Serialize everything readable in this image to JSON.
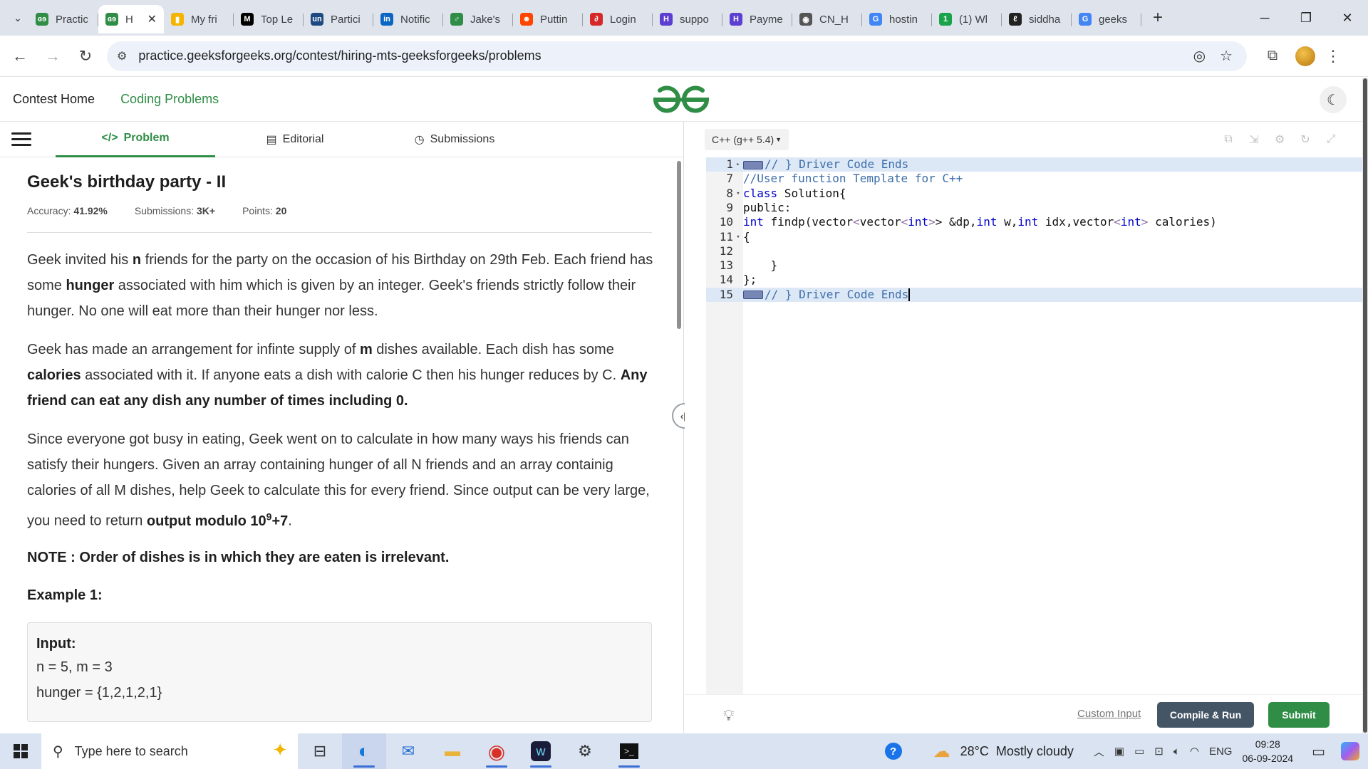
{
  "browser": {
    "tabs": [
      {
        "label": "Practic",
        "fav": "geeks-logo-icon",
        "color": "#2f8d46",
        "glyph": "ɞɘ"
      },
      {
        "label": "H",
        "fav": "geeks-logo-icon",
        "color": "#2f8d46",
        "glyph": "ɞɘ",
        "active": true
      },
      {
        "label": "My fri",
        "fav": "bar-chart-icon",
        "color": "#f4b400",
        "glyph": "▮"
      },
      {
        "label": "Top Le",
        "fav": "medium-icon",
        "color": "#000000",
        "glyph": "M"
      },
      {
        "label": "Partici",
        "fav": "unstop-icon",
        "color": "#1c4980",
        "glyph": "un"
      },
      {
        "label": "Notific",
        "fav": "linkedin-icon",
        "color": "#0a66c2",
        "glyph": "in"
      },
      {
        "label": "Jake's",
        "fav": "leetcode-icon",
        "color": "#2f8d46",
        "glyph": "♂"
      },
      {
        "label": "Puttin",
        "fav": "reddit-icon",
        "color": "#ff4500",
        "glyph": "☻"
      },
      {
        "label": "Login",
        "fav": "login-icon",
        "color": "#d62828",
        "glyph": "∂"
      },
      {
        "label": "suppo",
        "fav": "support-icon",
        "color": "#5b3fd1",
        "glyph": "H"
      },
      {
        "label": "Payme",
        "fav": "payment-icon",
        "color": "#5b3fd1",
        "glyph": "H"
      },
      {
        "label": "CN_H",
        "fav": "globe-icon",
        "color": "#555555",
        "glyph": "◉"
      },
      {
        "label": "hostin",
        "fav": "google-icon",
        "color": "#4285f4",
        "glyph": "G"
      },
      {
        "label": "(1) Wl",
        "fav": "whatsapp-icon",
        "color": "#1aa34a",
        "glyph": "1"
      },
      {
        "label": "siddha",
        "fav": "leetcode-icon",
        "color": "#222222",
        "glyph": "ℓ"
      },
      {
        "label": "geeks",
        "fav": "google-icon",
        "color": "#4285f4",
        "glyph": "G"
      }
    ],
    "url": "practice.geeksforgeeks.org/contest/hiring-mts-geeksforgeeks/problems"
  },
  "header": {
    "contest_home": "Contest Home",
    "coding_problems": "Coding Problems"
  },
  "problem_tabs": {
    "problem": "Problem",
    "editorial": "Editorial",
    "submissions": "Submissions"
  },
  "problem": {
    "title": "Geek's birthday party - II",
    "accuracy_label": "Accuracy:",
    "accuracy": "41.92%",
    "submissions_label": "Submissions:",
    "submissions": "3K+",
    "points_label": "Points:",
    "points": "20",
    "p1_a": "Geek invited his ",
    "p1_b": "n",
    "p1_c": " friends for the party on the occasion of his Birthday on 29th Feb. Each friend has some ",
    "p1_d": "hunger",
    "p1_e": " associated with him which is given by an integer. Geek's friends strictly follow their hunger. No one will eat more than their hunger nor less.",
    "p2_a": "Geek has made an arrangement for infinte supply of ",
    "p2_b": "m",
    "p2_c": " dishes available. Each dish has some ",
    "p2_d": "calories",
    "p2_e": " associated with it. If anyone eats a dish with calorie C then his hunger reduces by C. ",
    "p2_f": "Any friend can eat any dish any number of times including 0.",
    "p3_a": "Since everyone got busy in eating, Geek went on to calculate in how many ways his friends can satisfy their hungers. Given an array containing hunger of all N friends and an array containig calories of all M dishes, help Geek to calculate this for every friend. Since output can be very large, you need to return ",
    "p3_b": "output modulo 10",
    "p3_sup": "9",
    "p3_c": "+7",
    "p3_d": ".",
    "note": "NOTE : Order of dishes is in which they are eaten is irrelevant.",
    "example_heading": "Example 1:",
    "input_label": "Input:",
    "input_line1": "n = 5, m = 3",
    "input_line2": "hunger = {1,2,1,2,1}"
  },
  "editor": {
    "language": "C++ (g++ 5.4)",
    "lines": [
      {
        "num": "1",
        "fold": "▸",
        "fold_marker": true,
        "code": "// } Driver Code Ends",
        "highlight": true,
        "type": "comment"
      },
      {
        "num": "7",
        "fold": "",
        "code": "//User function Template for C++",
        "type": "comment"
      },
      {
        "num": "8",
        "fold": "▾",
        "code": "class Solution{",
        "type": "class"
      },
      {
        "num": "9",
        "fold": "",
        "code": "public:",
        "type": "plain"
      },
      {
        "num": "10",
        "fold": "",
        "code": "int findp(vector<vector<int>> &dp,int w,int idx,vector<int> calories)",
        "type": "func"
      },
      {
        "num": "11",
        "fold": "▾",
        "code": "{",
        "type": "plain"
      },
      {
        "num": "12",
        "fold": "",
        "code": "",
        "type": "plain"
      },
      {
        "num": "13",
        "fold": "",
        "code": "    }",
        "type": "plain"
      },
      {
        "num": "14",
        "fold": "",
        "code": "};",
        "type": "plain"
      },
      {
        "num": "15",
        "fold": "",
        "fold_marker": true,
        "code": "// } Driver Code Ends",
        "highlight": true,
        "type": "comment",
        "cursor": true
      }
    ],
    "custom_input": "Custom Input",
    "compile_run": "Compile & Run",
    "submit": "Submit"
  },
  "taskbar": {
    "search_placeholder": "Type here to search",
    "weather_temp": "28°C",
    "weather_text": "Mostly cloudy",
    "lang": "ENG",
    "time": "09:28",
    "date": "06-09-2024"
  },
  "colors": {
    "brand_green": "#2f8d46",
    "run_button": "#445566"
  }
}
